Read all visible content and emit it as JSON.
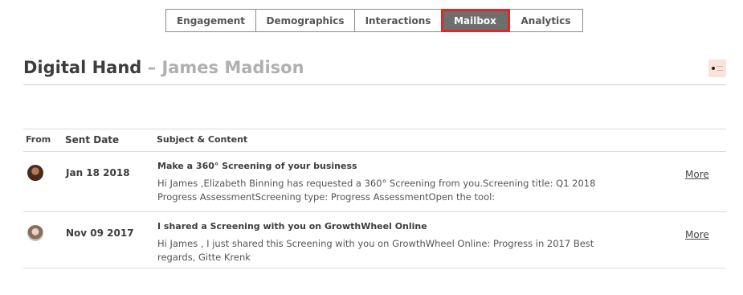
{
  "tabs": [
    {
      "label": "Engagement",
      "active": false
    },
    {
      "label": "Demographics",
      "active": false
    },
    {
      "label": "Interactions",
      "active": false
    },
    {
      "label": "Mailbox",
      "active": true
    },
    {
      "label": "Analytics",
      "active": false
    }
  ],
  "header": {
    "title": "Digital Hand",
    "separator": "–",
    "person": "James Madison",
    "badge_icon": "company-logo-icon"
  },
  "table": {
    "columns": [
      "From",
      "Sent Date",
      "Subject & Content"
    ],
    "rows": [
      {
        "avatar_icon": "sender-avatar",
        "date": "Jan 18 2018",
        "subject": "Make a 360° Screening of your business",
        "content": "Hi James ,Elizabeth Binning has requested a 360° Screening from you.Screening title: Q1 2018 Progress AssessmentScreening type: Progress AssessmentOpen the tool:",
        "more": "More"
      },
      {
        "avatar_icon": "sender-avatar",
        "date": "Nov 09 2017",
        "subject": "I shared a Screening with you on GrowthWheel Online",
        "content": "Hi James , I just shared this Screening with you on GrowthWheel Online: Progress in 2017 Best regards, Gitte Krenk",
        "more": "More"
      }
    ]
  },
  "colors": {
    "active_tab_bg": "#6e6e6e",
    "active_tab_highlight": "#e32626",
    "title": "#3d3d3d",
    "title_muted": "#b0b0b0"
  }
}
